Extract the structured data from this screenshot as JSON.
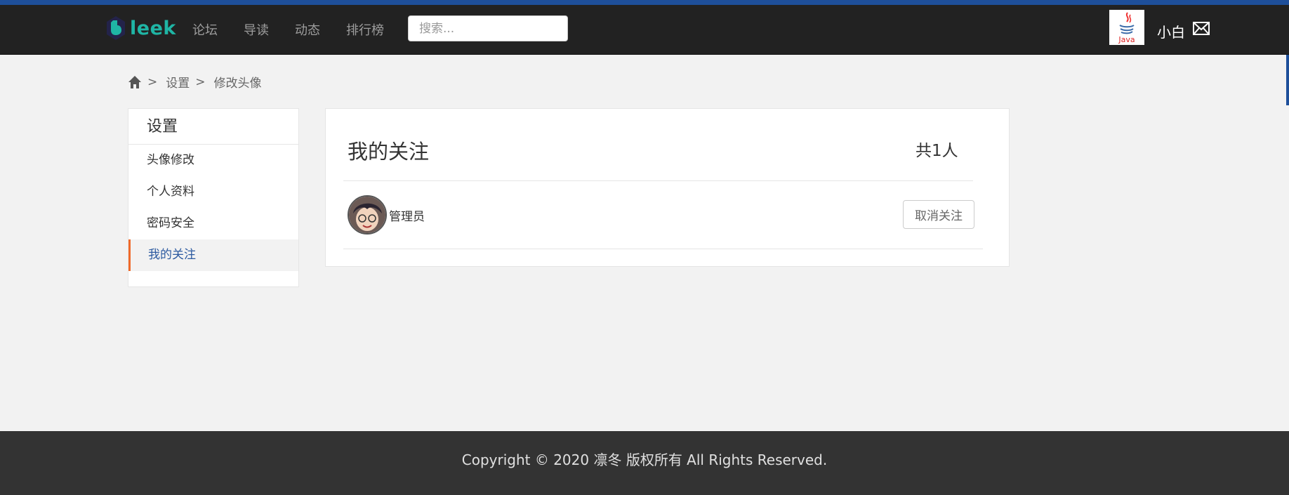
{
  "navbar": {
    "brand": "leek",
    "links": [
      "论坛",
      "导读",
      "动态",
      "排行榜"
    ],
    "search_placeholder": "搜索...",
    "username": "小白",
    "avatar_text": "Java",
    "colors": {
      "bar": "#222222",
      "brand": "#1fb5a5",
      "topline": "#1e4f9a"
    }
  },
  "breadcrumb": {
    "items": [
      "设置",
      "修改头像"
    ],
    "separator": ">"
  },
  "sidebar": {
    "title": "设置",
    "items": [
      "头像修改",
      "个人资料",
      "密码安全",
      "我的关注"
    ],
    "active_index": 3,
    "accent": "#f06a2a"
  },
  "panel": {
    "title": "我的关注",
    "count": "共1人",
    "follows": [
      {
        "name": "管理员",
        "button": "取消关注"
      }
    ]
  },
  "footer": {
    "text": "Copyright  © 2020  凛冬 版权所有 All Rights Reserved."
  }
}
